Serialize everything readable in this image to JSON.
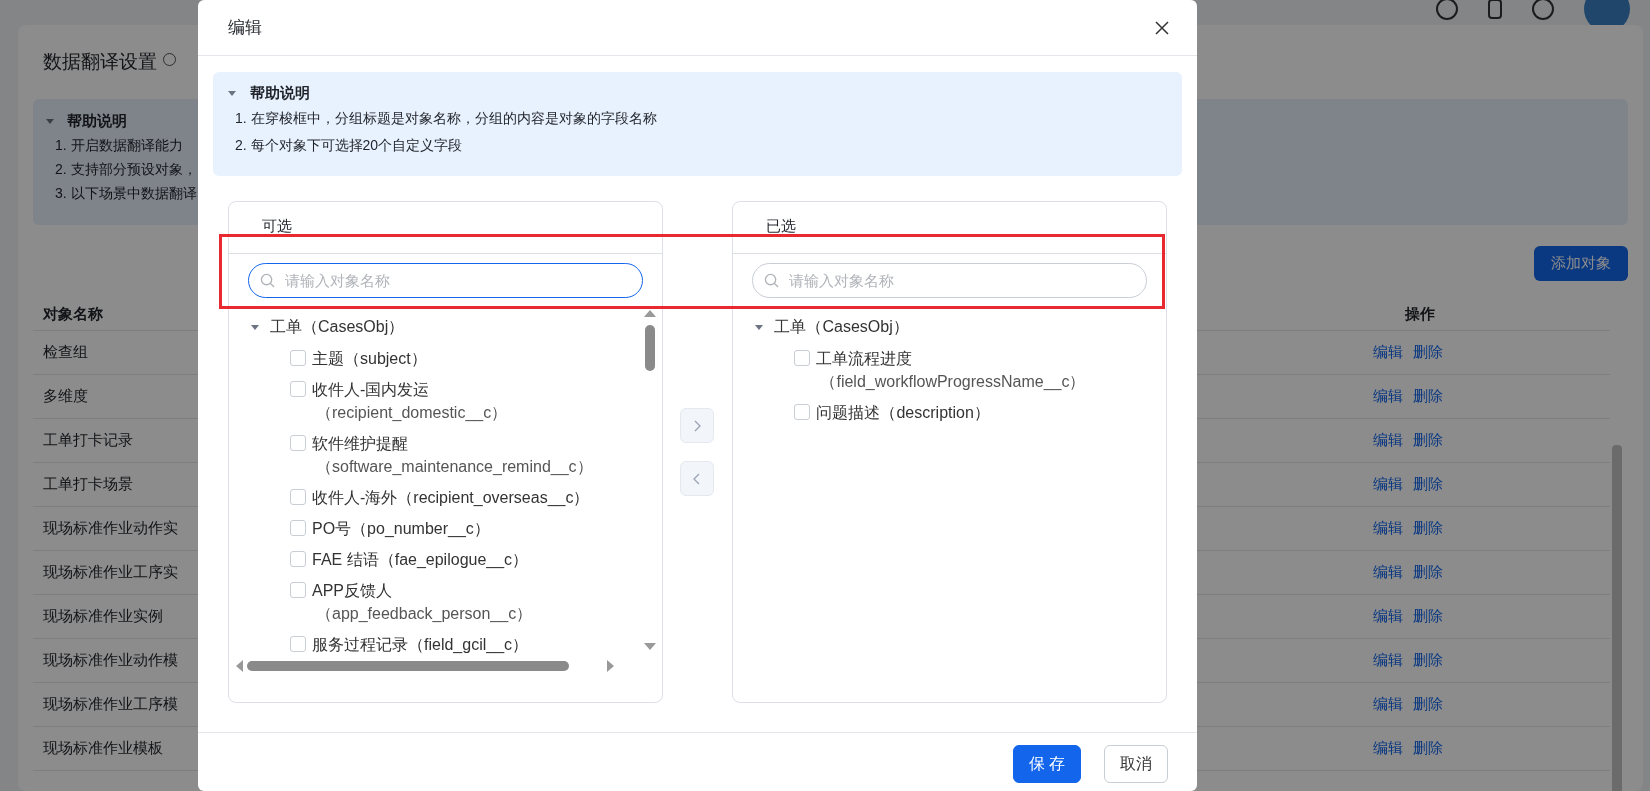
{
  "page": {
    "title": "数据翻译设置",
    "help": {
      "title": "帮助说明",
      "expanded": true,
      "lines": [
        "1. 开启数据翻译能力",
        "2. 支持部分预设对象，",
        "3. 以下场景中数据翻译"
      ]
    },
    "add_button": "添加对象",
    "table": {
      "columns": [
        "对象名称",
        "操作"
      ],
      "rows": [
        {
          "name": "检查组",
          "actions": [
            "编辑",
            "删除"
          ]
        },
        {
          "name": "多维度",
          "actions": [
            "编辑",
            "删除"
          ]
        },
        {
          "name": "工单打卡记录",
          "actions": [
            "编辑",
            "删除"
          ]
        },
        {
          "name": "工单打卡场景",
          "actions": [
            "编辑",
            "删除"
          ]
        },
        {
          "name": "现场标准作业动作实",
          "actions": [
            "编辑",
            "删除"
          ]
        },
        {
          "name": "现场标准作业工序实",
          "actions": [
            "编辑",
            "删除"
          ]
        },
        {
          "name": "现场标准作业实例",
          "actions": [
            "编辑",
            "删除"
          ]
        },
        {
          "name": "现场标准作业动作模",
          "actions": [
            "编辑",
            "删除"
          ]
        },
        {
          "name": "现场标准作业工序模",
          "actions": [
            "编辑",
            "删除"
          ]
        },
        {
          "name": "现场标准作业模板",
          "actions": [
            "编辑",
            "删除"
          ]
        }
      ]
    }
  },
  "dialog": {
    "title": "编辑",
    "help": {
      "title": "帮助说明",
      "expanded": true,
      "lines": [
        "1. 在穿梭框中，分组标题是对象名称，分组的内容是对象的字段名称",
        "2. 每个对象下可选择20个自定义字段"
      ]
    },
    "source": {
      "title": "可选",
      "search": {
        "placeholder": "请输入对象名称",
        "focused": true
      },
      "groups": [
        {
          "label": "工单（CasesObj）",
          "expanded": true,
          "items": [
            {
              "lines": [
                "主题（subject）"
              ],
              "checked": false
            },
            {
              "lines": [
                "收件人-国内发运",
                "（recipient_domestic__c）"
              ],
              "checked": false
            },
            {
              "lines": [
                "软件维护提醒",
                "（software_maintenance_remind__c）"
              ],
              "checked": false
            },
            {
              "lines": [
                "收件人-海外（recipient_overseas__c）"
              ],
              "checked": false
            },
            {
              "lines": [
                "PO号（po_number__c）"
              ],
              "checked": false
            },
            {
              "lines": [
                "FAE 结语（fae_epilogue__c）"
              ],
              "checked": false
            },
            {
              "lines": [
                "APP反馈人",
                "（app_feedback_person__c）"
              ],
              "checked": false
            },
            {
              "lines": [
                "服务过程记录（field_gcil__c）"
              ],
              "checked": false
            }
          ]
        }
      ]
    },
    "move_buttons": [
      {
        "kind": "forward",
        "disabled": true
      },
      {
        "kind": "back",
        "disabled": true
      }
    ],
    "target": {
      "title": "已选",
      "search": {
        "placeholder": "请输入对象名称",
        "focused": false
      },
      "groups": [
        {
          "label": "工单（CasesObj）",
          "expanded": true,
          "items": [
            {
              "lines": [
                "工单流程进度",
                "（field_workflowProgressName__c）"
              ],
              "checked": false
            },
            {
              "lines": [
                "问题描述（description）"
              ],
              "checked": false
            }
          ]
        }
      ]
    },
    "buttons": [
      {
        "label": "保 存",
        "kind": "primary"
      },
      {
        "label": "取消",
        "kind": "default"
      }
    ]
  }
}
